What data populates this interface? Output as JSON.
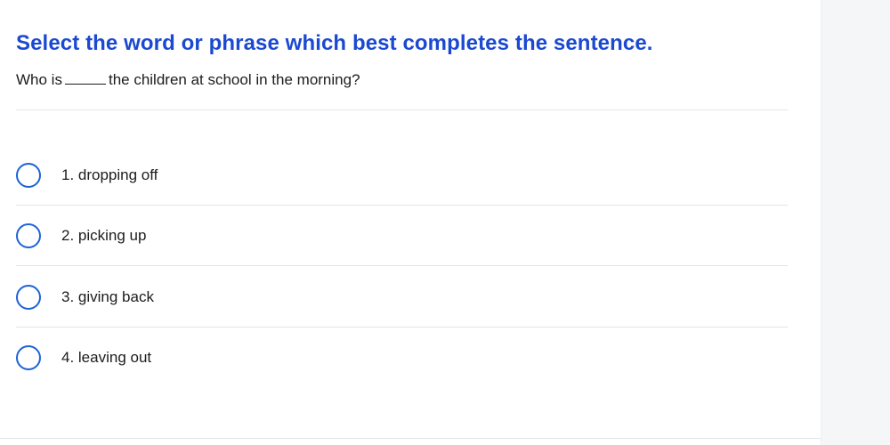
{
  "quiz": {
    "instruction": "Select the word or phrase which best completes the sentence.",
    "question": {
      "before_blank": "Who is",
      "after_blank": "the children at school in the morning?"
    },
    "options": [
      {
        "label": "1. dropping off",
        "selected": false
      },
      {
        "label": "2. picking up",
        "selected": false
      },
      {
        "label": "3. giving back",
        "selected": false
      },
      {
        "label": "4. leaving out",
        "selected": false
      }
    ]
  },
  "colors": {
    "accent": "#1b49d1",
    "radio_border": "#1e63d6",
    "text": "#1c1c1c",
    "side_panel": "#f5f6f8"
  }
}
